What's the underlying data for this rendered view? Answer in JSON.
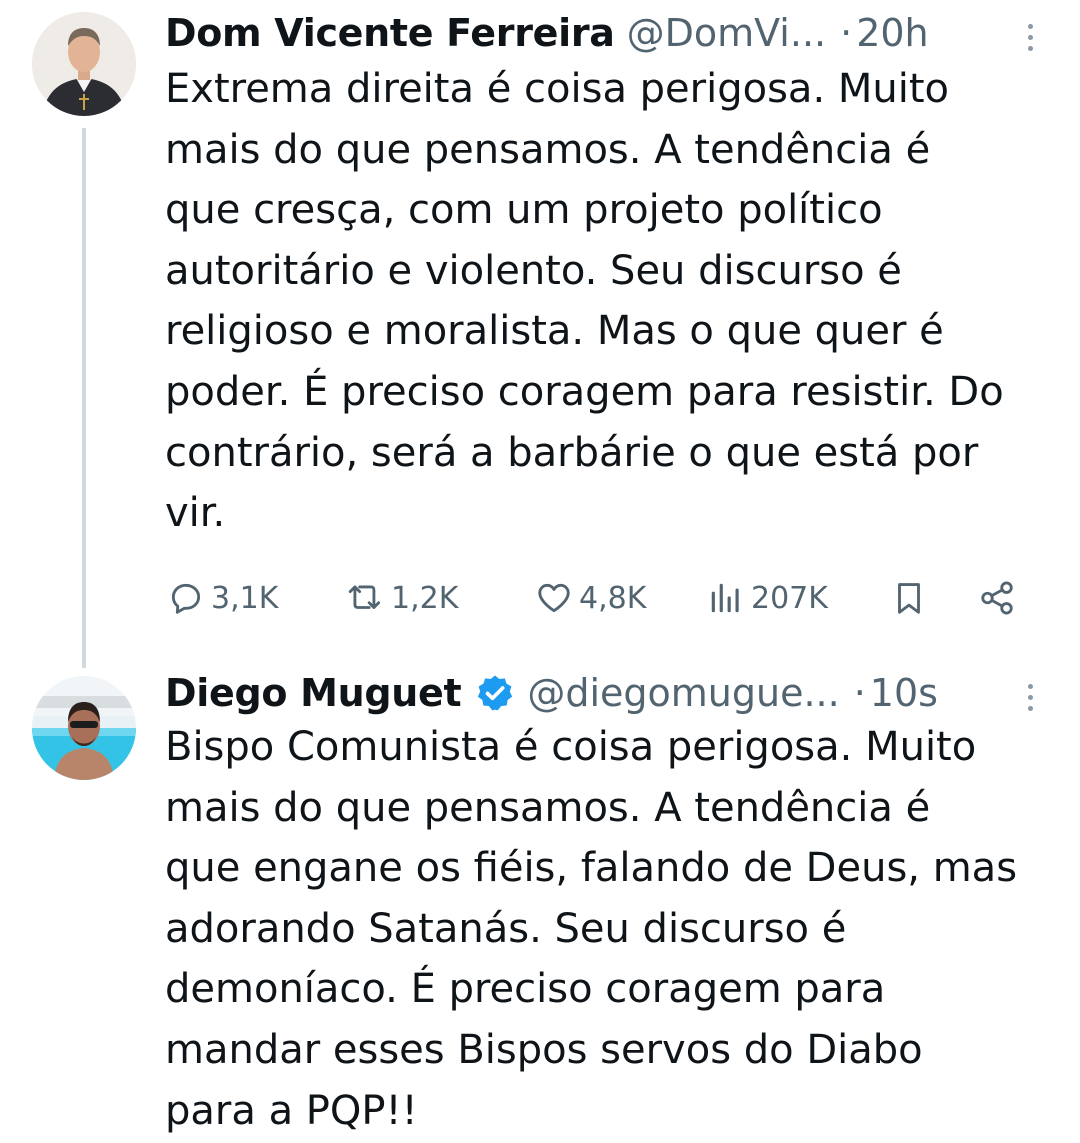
{
  "tweets": [
    {
      "author_name": "Dom Vicente Ferreira",
      "handle": "@DomVi...",
      "time": "20h",
      "text": "Extrema direita é coisa perigosa. Muito\nmais do que pensamos. A tendência é\nque cresça, com um projeto político\nautoritário e violento. Seu discurso é\nreligioso e moralista. Mas o que quer é\npoder. É preciso coragem para resistir. Do\ncontrário, será a barbárie o que está por\nvir.",
      "metrics": {
        "replies": "3,1K",
        "retweets": "1,2K",
        "likes": "4,8K",
        "views": "207K"
      },
      "avatar_icon": "priest-avatar-icon"
    },
    {
      "author_name": "Diego Muguet",
      "handle": "@diegomugue...",
      "time": "10s",
      "verified": true,
      "text": "Bispo Comunista é coisa perigosa. Muito\nmais do que pensamos. A tendência é\nque engane os fiéis, falando de Deus, mas\nadorando Satanás. Seu discurso é\ndemoníaco. É preciso coragem para\nmandar esses Bispos servos do Diabo\npara a PQP!!",
      "avatar_icon": "pool-selfie-avatar-icon"
    }
  ],
  "separator": "·",
  "colors": {
    "text": "#0f1419",
    "secondary": "#536471",
    "verified": "#1d9bf0",
    "thread_line": "#cfd9de"
  }
}
